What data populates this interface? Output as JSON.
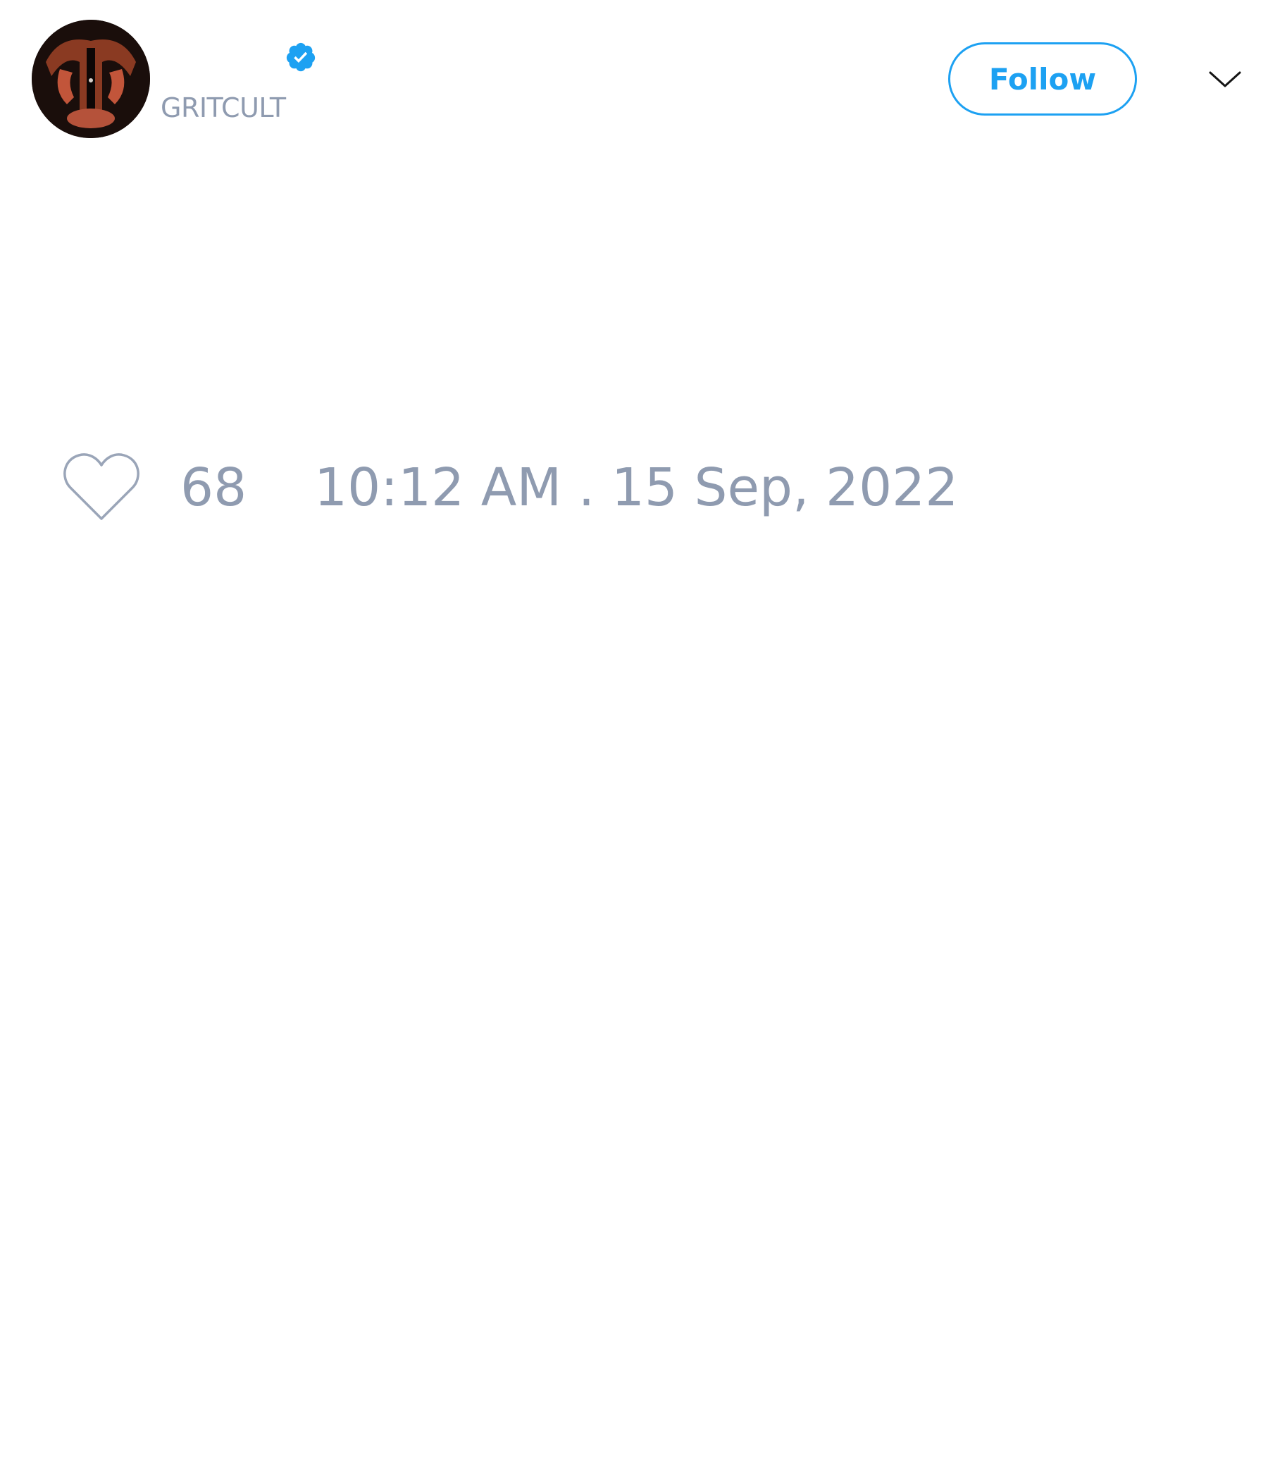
{
  "tweet": {
    "author": {
      "handle": "GRITCULT",
      "verified": true,
      "avatar_icon": "profile-avatar"
    },
    "follow_label": "Follow",
    "menu_icon": "chevron-down-icon",
    "likes": {
      "icon": "heart-icon",
      "count": "68"
    },
    "timestamp": "10:12 AM . 15 Sep, 2022"
  },
  "colors": {
    "accent": "#1da1f2",
    "muted_text": "#8f9bb0",
    "background": "#ffffff"
  }
}
